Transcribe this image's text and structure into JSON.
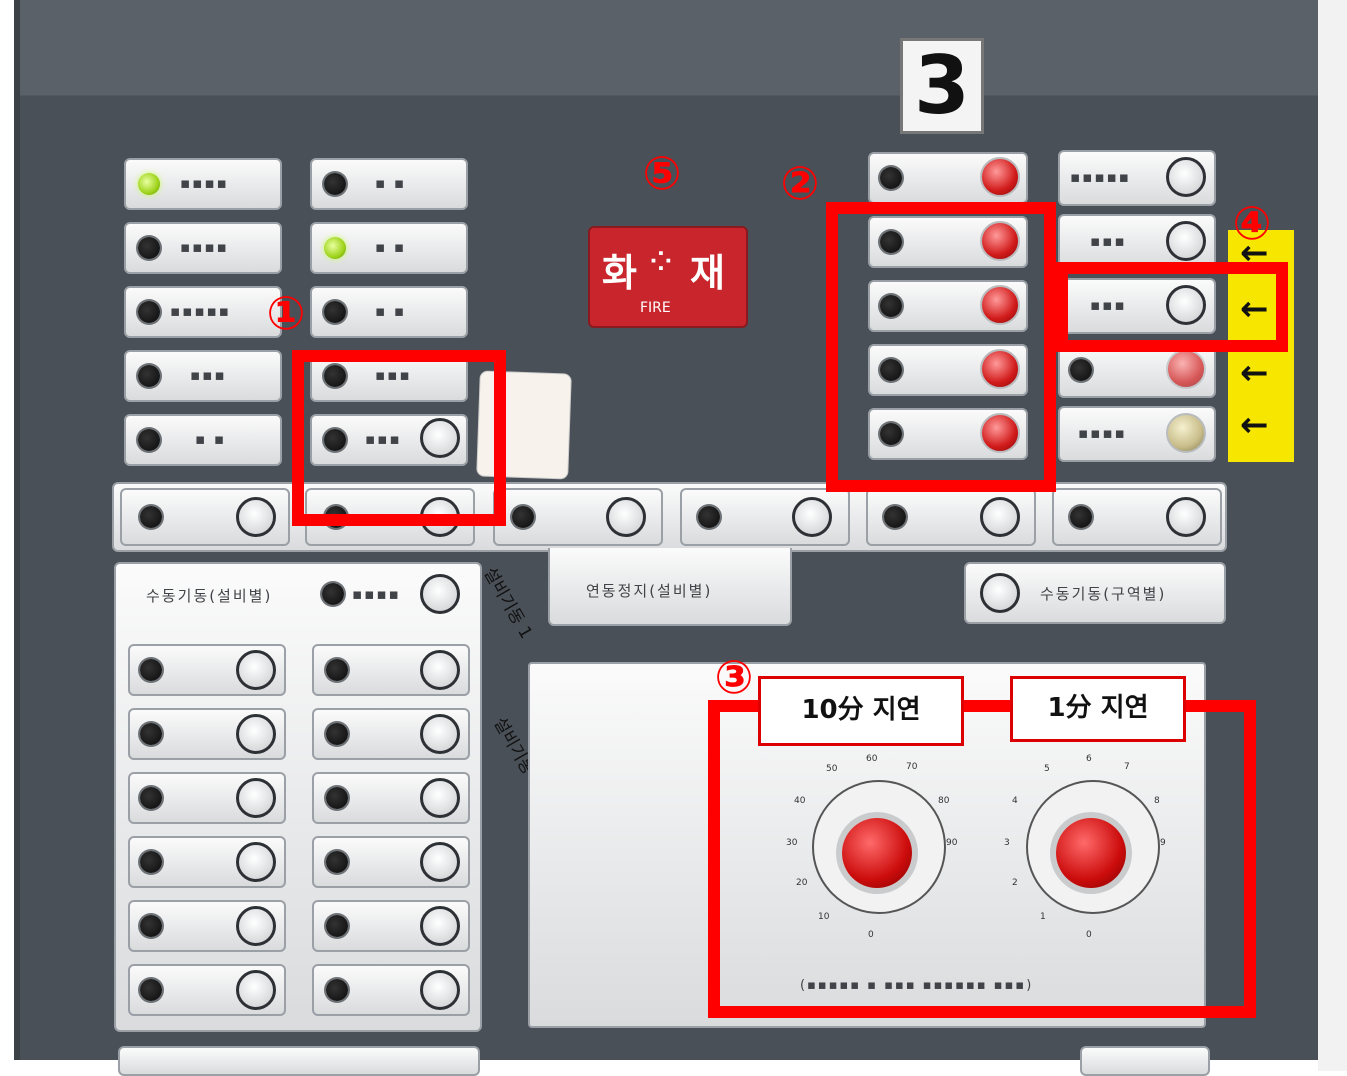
{
  "display_number": "3",
  "fire_sign": {
    "left": "화",
    "right": "재",
    "sub": "FIRE"
  },
  "callouts": [
    "①",
    "②",
    "③",
    "④",
    "⑤"
  ],
  "timer_labels": {
    "left": "10分 지연",
    "right": "1分 지연"
  },
  "left_knob_ticks": [
    "0",
    "10",
    "20",
    "30",
    "40",
    "50",
    "60",
    "70",
    "80",
    "90"
  ],
  "right_knob_ticks": [
    "0",
    "1",
    "2",
    "3",
    "4",
    "5",
    "6",
    "7",
    "8",
    "9"
  ],
  "manual_panel_title": "수동기동(설비별)",
  "interlock_stop": "연동정지(설비별)",
  "manual_zone": "수동기동(구역별)",
  "handwriting": {
    "h1": "설비기동 1",
    "h2": "설비기동 2"
  },
  "colors": {
    "panel": "#4a5057",
    "callout": "#ff0000",
    "lamp_red": "#d11b1b",
    "led_green": "#9ed31a",
    "tag_yellow": "#f7e600"
  },
  "icons": [
    "arrow-left-icon",
    "arrow-left-icon",
    "arrow-left-icon",
    "arrow-left-icon"
  ]
}
